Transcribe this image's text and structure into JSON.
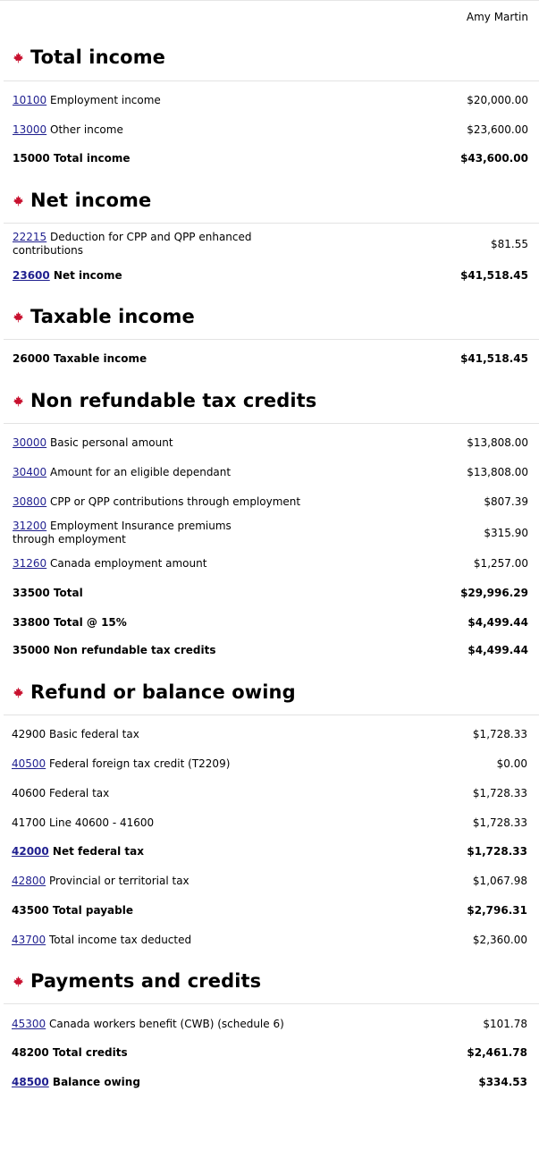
{
  "header": {
    "user_name": "Amy Martin"
  },
  "colors": {
    "leaf": "#c8102e",
    "link": "#1f1f8f",
    "rule": "#e3e3e3"
  },
  "sections": {
    "total_income": {
      "title": "Total income",
      "rows": [
        {
          "code": "10100",
          "label": " Employment income",
          "amount": "$20,000.00"
        },
        {
          "code": "13000",
          "label": " Other income",
          "amount": "$23,600.00"
        },
        {
          "code": "15000",
          "label": " Total income",
          "amount": "$43,600.00"
        }
      ]
    },
    "net_income": {
      "title": "Net income",
      "rows": [
        {
          "code": "22215",
          "label": " Deduction for CPP and QPP enhanced contributions",
          "amount": "$81.55"
        },
        {
          "code": "23600",
          "label": " Net income",
          "amount": "$41,518.45"
        }
      ]
    },
    "taxable_income": {
      "title": "Taxable income",
      "rows": [
        {
          "code": "26000",
          "label": " Taxable income",
          "amount": "$41,518.45"
        }
      ]
    },
    "non_refundable": {
      "title": "Non refundable tax credits",
      "rows": [
        {
          "code": "30000",
          "label": " Basic personal amount",
          "amount": "$13,808.00"
        },
        {
          "code": "30400",
          "label": " Amount for an eligible dependant",
          "amount": "$13,808.00"
        },
        {
          "code": "30800",
          "label": " CPP or QPP contributions through employment",
          "amount": "$807.39"
        },
        {
          "code": "31200",
          "label": " Employment Insurance premiums through employment",
          "amount": "$315.90"
        },
        {
          "code": "31260",
          "label": " Canada employment amount",
          "amount": "$1,257.00"
        },
        {
          "code": "33500",
          "label": " Total",
          "amount": "$29,996.29"
        },
        {
          "code": "33800",
          "label": " Total @ 15%",
          "amount": "$4,499.44"
        },
        {
          "code": "35000",
          "label": " Non refundable tax credits",
          "amount": "$4,499.44"
        }
      ]
    },
    "refund": {
      "title": "Refund or balance owing",
      "rows": [
        {
          "code": "42900",
          "label": " Basic federal tax",
          "amount": "$1,728.33"
        },
        {
          "code": "40500",
          "label": " Federal foreign tax credit (T2209)",
          "amount": "$0.00"
        },
        {
          "code": "40600",
          "label": " Federal tax",
          "amount": "$1,728.33"
        },
        {
          "code": "41700",
          "label": " Line 40600 - 41600",
          "amount": "$1,728.33"
        },
        {
          "code": "42000",
          "label": " Net federal tax",
          "amount": "$1,728.33"
        },
        {
          "code": "42800",
          "label": " Provincial or territorial tax",
          "amount": "$1,067.98"
        },
        {
          "code": "43500",
          "label": " Total payable",
          "amount": "$2,796.31"
        },
        {
          "code": "43700",
          "label": " Total income tax deducted",
          "amount": "$2,360.00"
        }
      ]
    },
    "payments": {
      "title": "Payments and credits",
      "rows": [
        {
          "code": "45300",
          "label": " Canada workers benefit (CWB) (schedule 6)",
          "amount": "$101.78"
        },
        {
          "code": "48200",
          "label": " Total credits",
          "amount": "$2,461.78"
        },
        {
          "code": "48500",
          "label": " Balance owing",
          "amount": "$334.53"
        }
      ]
    }
  }
}
